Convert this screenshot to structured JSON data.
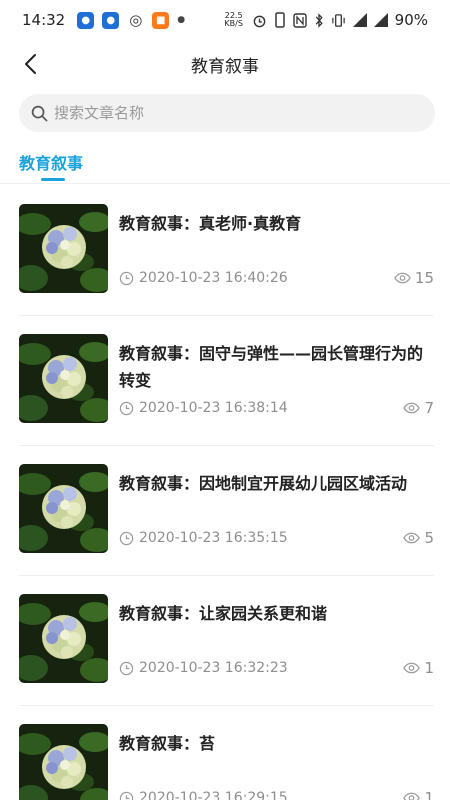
{
  "status_bar": {
    "time": "14:32",
    "net_speed": "22.5",
    "net_unit": "KB/S",
    "battery": "90%"
  },
  "header": {
    "title": "教育叙事"
  },
  "search": {
    "placeholder": "搜索文章名称"
  },
  "tabs": [
    {
      "label": "教育叙事",
      "active": true
    }
  ],
  "colors": {
    "accent": "#1aa3dc",
    "meta_text": "#8e8e8e",
    "divider": "#eeeeee"
  },
  "articles": [
    {
      "title": "教育叙事：真老师·真教育",
      "date": "2020-10-23 16:40:26",
      "views": "15"
    },
    {
      "title": "教育叙事：固守与弹性——园长管理行为的转变",
      "date": "2020-10-23 16:38:14",
      "views": "7"
    },
    {
      "title": "教育叙事：因地制宜开展幼儿园区域活动",
      "date": "2020-10-23 16:35:15",
      "views": "5"
    },
    {
      "title": "教育叙事：让家园关系更和谐",
      "date": "2020-10-23 16:32:23",
      "views": "1"
    },
    {
      "title": "教育叙事：苔",
      "date": "2020-10-23 16:29:15",
      "views": "1"
    }
  ]
}
